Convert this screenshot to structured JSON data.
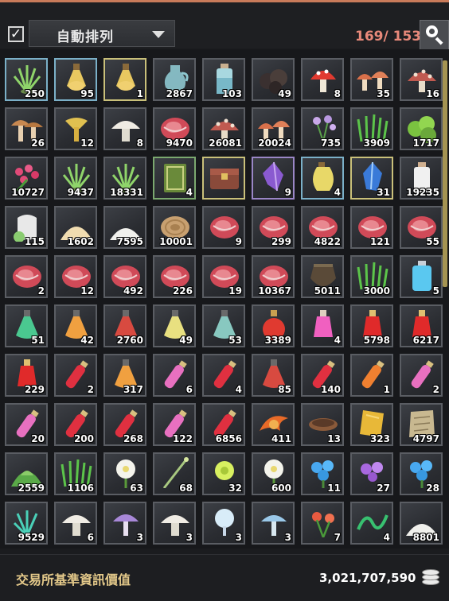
{
  "header": {
    "auto_sort_checked": "✓",
    "sort_label": "自動排列",
    "capacity": "169/ 153"
  },
  "footer": {
    "label": "交易所基準資訊價值",
    "value": "3,021,707,590"
  },
  "colors": {
    "accent_capacity": "#e8897a",
    "footer_label": "#e4c98a",
    "scrollbar": "#a59452"
  },
  "slots": [
    {
      "icon": "herb-icon",
      "qty": "250",
      "rarity": "blue"
    },
    {
      "icon": "elixir-flask-icon",
      "qty": "95",
      "rarity": "blue"
    },
    {
      "icon": "elixir-flask-icon",
      "qty": "1",
      "rarity": "yellow"
    },
    {
      "icon": "glass-jug-icon",
      "qty": "2867",
      "rarity": ""
    },
    {
      "icon": "water-bottle-icon",
      "qty": "103",
      "rarity": ""
    },
    {
      "icon": "truffle-icon",
      "qty": "49",
      "rarity": ""
    },
    {
      "icon": "red-mushroom-icon",
      "qty": "8",
      "rarity": ""
    },
    {
      "icon": "mushroom-cluster-icon",
      "qty": "35",
      "rarity": ""
    },
    {
      "icon": "spotted-mushroom-icon",
      "qty": "16",
      "rarity": ""
    },
    {
      "icon": "brown-mushroom-icon",
      "qty": "26",
      "rarity": ""
    },
    {
      "icon": "chanterelle-icon",
      "qty": "12",
      "rarity": ""
    },
    {
      "icon": "white-mushroom-icon",
      "qty": "8",
      "rarity": ""
    },
    {
      "icon": "meat-icon",
      "qty": "9470",
      "rarity": ""
    },
    {
      "icon": "spotted-mushroom-icon",
      "qty": "26081",
      "rarity": ""
    },
    {
      "icon": "mushroom-cluster-icon",
      "qty": "20024",
      "rarity": ""
    },
    {
      "icon": "flower-bush-icon",
      "qty": "735",
      "rarity": ""
    },
    {
      "icon": "grass-icon",
      "qty": "3909",
      "rarity": ""
    },
    {
      "icon": "green-bush-icon",
      "qty": "1717",
      "rarity": ""
    },
    {
      "icon": "rose-icon",
      "qty": "10727",
      "rarity": ""
    },
    {
      "icon": "herb-icon",
      "qty": "9437",
      "rarity": ""
    },
    {
      "icon": "herb-icon",
      "qty": "18331",
      "rarity": ""
    },
    {
      "icon": "book-icon",
      "qty": "4",
      "rarity": "green"
    },
    {
      "icon": "chest-icon",
      "qty": "",
      "rarity": "yellow"
    },
    {
      "icon": "purple-crystal-icon",
      "qty": "9",
      "rarity": "purple"
    },
    {
      "icon": "oil-jar-icon",
      "qty": "4",
      "rarity": "blue"
    },
    {
      "icon": "blue-crystal-icon",
      "qty": "31",
      "rarity": "yellow"
    },
    {
      "icon": "milk-bottle-icon",
      "qty": "19235",
      "rarity": ""
    },
    {
      "icon": "milk-jug-icon",
      "qty": "115",
      "rarity": ""
    },
    {
      "icon": "flour-pile-icon",
      "qty": "1602",
      "rarity": ""
    },
    {
      "icon": "salt-pile-icon",
      "qty": "7595",
      "rarity": ""
    },
    {
      "icon": "rope-coil-icon",
      "qty": "10001",
      "rarity": ""
    },
    {
      "icon": "meat-icon",
      "qty": "9",
      "rarity": ""
    },
    {
      "icon": "meat-icon",
      "qty": "299",
      "rarity": ""
    },
    {
      "icon": "meat-icon",
      "qty": "4822",
      "rarity": ""
    },
    {
      "icon": "meat-icon",
      "qty": "121",
      "rarity": ""
    },
    {
      "icon": "meat-icon",
      "qty": "55",
      "rarity": ""
    },
    {
      "icon": "meat-icon",
      "qty": "2",
      "rarity": ""
    },
    {
      "icon": "meat-icon",
      "qty": "12",
      "rarity": ""
    },
    {
      "icon": "meat-icon",
      "qty": "492",
      "rarity": ""
    },
    {
      "icon": "meat-icon",
      "qty": "226",
      "rarity": ""
    },
    {
      "icon": "meat-icon",
      "qty": "19",
      "rarity": ""
    },
    {
      "icon": "meat-icon",
      "qty": "10367",
      "rarity": ""
    },
    {
      "icon": "clay-pot-icon",
      "qty": "5011",
      "rarity": ""
    },
    {
      "icon": "grass-icon",
      "qty": "3000",
      "rarity": ""
    },
    {
      "icon": "blue-potion-icon",
      "qty": "5",
      "rarity": ""
    },
    {
      "icon": "green-flask-icon",
      "qty": "51",
      "rarity": ""
    },
    {
      "icon": "orange-flask-icon",
      "qty": "42",
      "rarity": ""
    },
    {
      "icon": "red-flask-icon",
      "qty": "2760",
      "rarity": ""
    },
    {
      "icon": "yellow-flask-icon",
      "qty": "49",
      "rarity": ""
    },
    {
      "icon": "teal-flask-icon",
      "qty": "53",
      "rarity": ""
    },
    {
      "icon": "red-round-potion-icon",
      "qty": "3389",
      "rarity": ""
    },
    {
      "icon": "pink-potion-icon",
      "qty": "4",
      "rarity": ""
    },
    {
      "icon": "red-potion-icon",
      "qty": "5798",
      "rarity": ""
    },
    {
      "icon": "red-potion-icon",
      "qty": "6217",
      "rarity": ""
    },
    {
      "icon": "red-potion-icon",
      "qty": "229",
      "rarity": ""
    },
    {
      "icon": "red-vial-icon",
      "qty": "2",
      "rarity": ""
    },
    {
      "icon": "orange-flask-icon",
      "qty": "317",
      "rarity": ""
    },
    {
      "icon": "pink-vial-icon",
      "qty": "6",
      "rarity": ""
    },
    {
      "icon": "red-vial-icon",
      "qty": "4",
      "rarity": ""
    },
    {
      "icon": "red-flask-icon",
      "qty": "85",
      "rarity": ""
    },
    {
      "icon": "red-vial-icon",
      "qty": "140",
      "rarity": ""
    },
    {
      "icon": "orange-vial-icon",
      "qty": "1",
      "rarity": ""
    },
    {
      "icon": "pink-vial-icon",
      "qty": "2",
      "rarity": ""
    },
    {
      "icon": "pink-vial-icon",
      "qty": "20",
      "rarity": ""
    },
    {
      "icon": "red-vial-icon",
      "qty": "200",
      "rarity": ""
    },
    {
      "icon": "red-vial-icon",
      "qty": "268",
      "rarity": ""
    },
    {
      "icon": "pink-vial-icon",
      "qty": "122",
      "rarity": ""
    },
    {
      "icon": "red-vial-icon",
      "qty": "6856",
      "rarity": ""
    },
    {
      "icon": "flame-swirl-icon",
      "qty": "411",
      "rarity": ""
    },
    {
      "icon": "bowl-icon",
      "qty": "13",
      "rarity": ""
    },
    {
      "icon": "gold-leaf-icon",
      "qty": "323",
      "rarity": ""
    },
    {
      "icon": "parchment-icon",
      "qty": "4797",
      "rarity": ""
    },
    {
      "icon": "green-powder-icon",
      "qty": "2559",
      "rarity": ""
    },
    {
      "icon": "grass-icon",
      "qty": "1106",
      "rarity": ""
    },
    {
      "icon": "white-flower-icon",
      "qty": "63",
      "rarity": ""
    },
    {
      "icon": "stem-icon",
      "qty": "68",
      "rarity": ""
    },
    {
      "icon": "yellow-flower-icon",
      "qty": "32",
      "rarity": ""
    },
    {
      "icon": "white-flower-icon",
      "qty": "600",
      "rarity": ""
    },
    {
      "icon": "blue-flower-icon",
      "qty": "11",
      "rarity": ""
    },
    {
      "icon": "purple-flower-icon",
      "qty": "27",
      "rarity": ""
    },
    {
      "icon": "blue-flower-icon",
      "qty": "28",
      "rarity": ""
    },
    {
      "icon": "teal-herb-icon",
      "qty": "9529",
      "rarity": ""
    },
    {
      "icon": "white-mushroom-icon",
      "qty": "6",
      "rarity": ""
    },
    {
      "icon": "purple-mushroom-icon",
      "qty": "3",
      "rarity": ""
    },
    {
      "icon": "white-mushroom-icon",
      "qty": "3",
      "rarity": ""
    },
    {
      "icon": "glow-mushroom-icon",
      "qty": "3",
      "rarity": ""
    },
    {
      "icon": "blue-mushroom-icon",
      "qty": "3",
      "rarity": ""
    },
    {
      "icon": "red-flower-icon",
      "qty": "7",
      "rarity": ""
    },
    {
      "icon": "green-vine-icon",
      "qty": "4",
      "rarity": ""
    },
    {
      "icon": "salt-pile-icon",
      "qty": "8801",
      "rarity": ""
    }
  ]
}
